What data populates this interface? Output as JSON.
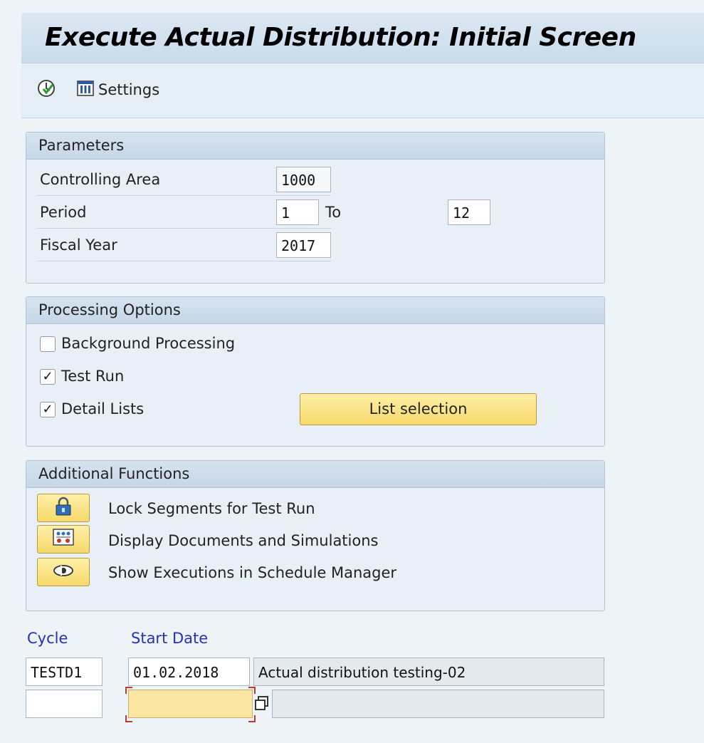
{
  "title": "Execute Actual Distribution: Initial Screen",
  "toolbar": {
    "settings_label": "Settings"
  },
  "parameters": {
    "header": "Parameters",
    "controlling_area_label": "Controlling Area",
    "controlling_area_value": "1000",
    "period_label": "Period",
    "period_from": "1",
    "period_to_label": "To",
    "period_to": "12",
    "fiscal_year_label": "Fiscal Year",
    "fiscal_year_value": "2017"
  },
  "processing": {
    "header": "Processing Options",
    "background_label": "Background Processing",
    "background_checked": false,
    "test_run_label": "Test Run",
    "test_run_checked": true,
    "detail_lists_label": "Detail Lists",
    "detail_lists_checked": true,
    "list_selection_label": "List selection"
  },
  "additional": {
    "header": "Additional Functions",
    "items": [
      {
        "label": "Lock Segments for Test Run",
        "icon": "lock-icon"
      },
      {
        "label": "Display Documents and Simulations",
        "icon": "documents-icon"
      },
      {
        "label": "Show Executions in Schedule Manager",
        "icon": "schedule-manager-icon"
      }
    ]
  },
  "cycles": {
    "cycle_header": "Cycle",
    "start_date_header": "Start Date",
    "rows": [
      {
        "cycle": "TESTD1",
        "start_date": "01.02.2018",
        "description": "Actual distribution testing-02"
      },
      {
        "cycle": "",
        "start_date": "",
        "description": ""
      }
    ]
  },
  "colors": {
    "accent_yellow": "#f6d96b",
    "label_blue": "#2233bb",
    "group_header": "#c6d7e8"
  }
}
